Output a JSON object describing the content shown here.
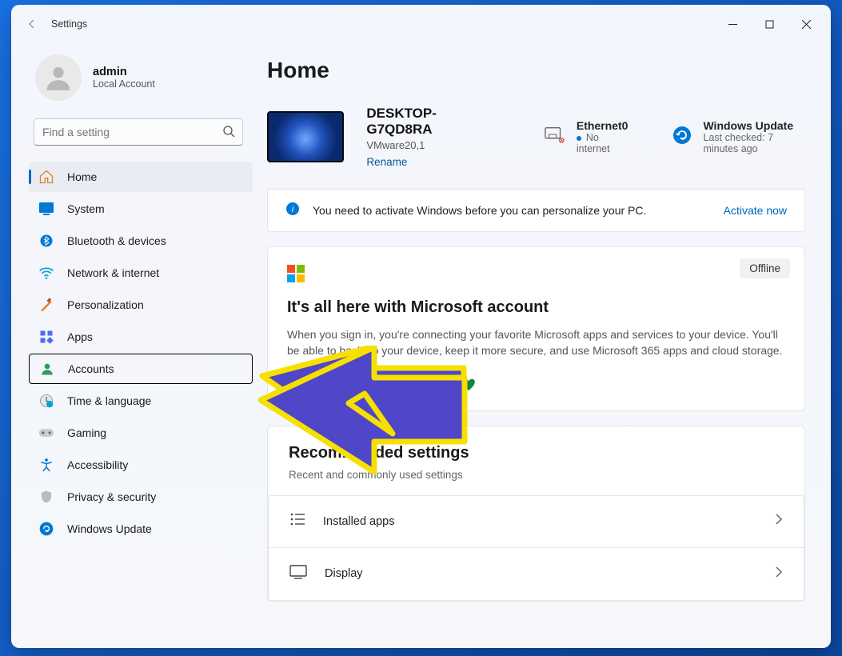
{
  "titlebar": {
    "title": "Settings"
  },
  "user": {
    "name": "admin",
    "sub": "Local Account"
  },
  "search": {
    "placeholder": "Find a setting"
  },
  "nav": {
    "items": [
      {
        "label": "Home"
      },
      {
        "label": "System"
      },
      {
        "label": "Bluetooth & devices"
      },
      {
        "label": "Network & internet"
      },
      {
        "label": "Personalization"
      },
      {
        "label": "Apps"
      },
      {
        "label": "Accounts"
      },
      {
        "label": "Time & language"
      },
      {
        "label": "Gaming"
      },
      {
        "label": "Accessibility"
      },
      {
        "label": "Privacy & security"
      },
      {
        "label": "Windows Update"
      }
    ]
  },
  "page": {
    "title": "Home"
  },
  "device": {
    "name": "DESKTOP-G7QD8RA",
    "model": "VMware20,1",
    "rename": "Rename"
  },
  "network": {
    "name": "Ethernet0",
    "status": "No internet"
  },
  "update": {
    "title": "Windows Update",
    "status": "Last checked: 7 minutes ago"
  },
  "banner": {
    "text": "You need to activate Windows before you can personalize your PC.",
    "action": "Activate now"
  },
  "ms_card": {
    "offline": "Offline",
    "title": "It's all here with Microsoft account",
    "body": "When you sign in, you're connecting your favorite Microsoft apps and services to your device. You'll be able to back up your device, keep it more secure, and use Microsoft 365 apps and cloud storage."
  },
  "recommended": {
    "title": "Recommended settings",
    "sub": "Recent and commonly used settings",
    "items": [
      {
        "label": "Installed apps"
      },
      {
        "label": "Display"
      }
    ]
  }
}
